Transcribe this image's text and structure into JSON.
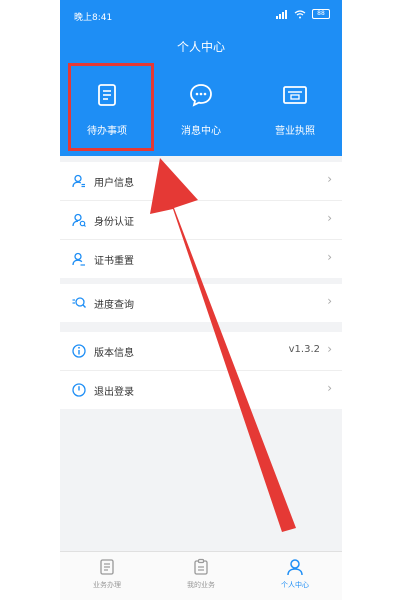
{
  "status_bar": {
    "time": "晚上8:41",
    "battery": "88"
  },
  "header": {
    "title": "个人中心"
  },
  "quick_actions": [
    {
      "label": "待办事项",
      "icon": "todo-list-icon"
    },
    {
      "label": "消息中心",
      "icon": "message-chat-icon"
    },
    {
      "label": "营业执照",
      "icon": "business-license-icon"
    }
  ],
  "menu_groups": [
    [
      {
        "label": "用户信息",
        "icon": "user-info-icon"
      },
      {
        "label": "身份认证",
        "icon": "identity-auth-icon"
      },
      {
        "label": "证书重置",
        "icon": "certificate-reset-icon"
      }
    ],
    [
      {
        "label": "进度查询",
        "icon": "progress-search-icon"
      }
    ],
    [
      {
        "label": "版本信息",
        "icon": "info-icon",
        "value": "v1.3.2"
      },
      {
        "label": "退出登录",
        "icon": "power-icon"
      }
    ]
  ],
  "tab_bar": [
    {
      "label": "业务办理",
      "icon": "business-handle-icon"
    },
    {
      "label": "我的业务",
      "icon": "my-business-icon"
    },
    {
      "label": "个人中心",
      "icon": "profile-icon",
      "active": true
    }
  ],
  "colors": {
    "primary": "#1e8ef5",
    "annotation": "#e53935"
  }
}
